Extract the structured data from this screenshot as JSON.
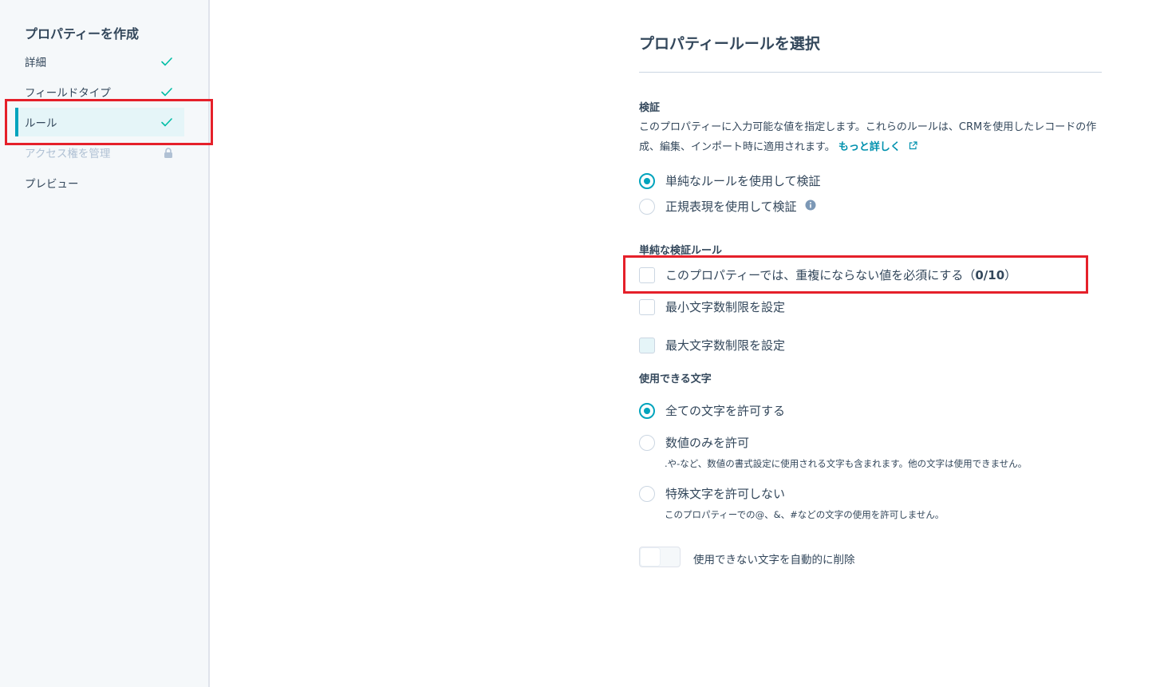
{
  "sidebar": {
    "title": "プロパティーを作成",
    "steps": [
      {
        "label": "詳細",
        "status": "check-icon"
      },
      {
        "label": "フィールドタイプ",
        "status": "check-icon"
      },
      {
        "label": "ルール",
        "status": "check-icon",
        "active": true
      },
      {
        "label": "アクセス権を管理",
        "status": "lock-icon",
        "disabled": true
      },
      {
        "label": "プレビュー"
      }
    ]
  },
  "main": {
    "title": "プロパティールールを選択",
    "validation": {
      "label": "検証",
      "description": "このプロパティーに入力可能な値を指定します。これらのルールは、CRMを使用したレコードの作成、編集、インポート時に適用されます。",
      "learn_more": "もっと詳しく",
      "options": [
        {
          "label": "単純なルールを使用して検証",
          "checked": true
        },
        {
          "label": "正規表現を使用して検証",
          "checked": false,
          "icon": "info-icon"
        }
      ]
    },
    "simple_rules": {
      "label": "単純な検証ルール",
      "options": [
        {
          "label": "このプロパティーでは、重複にならない値を必須にする（",
          "count": "0/10",
          "suffix": "）"
        },
        {
          "label": "最小文字数制限を設定"
        },
        {
          "label": "最大文字数制限を設定",
          "disabled": true
        }
      ]
    },
    "allowed_chars": {
      "label": "使用できる文字",
      "options": [
        {
          "label": "全ての文字を許可する",
          "checked": true
        },
        {
          "label": "数値のみを許可",
          "checked": false,
          "description": ".や-など、数値の書式設定に使用される文字も含まれます。他の文字は使用できません。"
        },
        {
          "label": "特殊文字を許可しない",
          "checked": false,
          "description": "このプロパティーでの@、&、#などの文字の使用を許可しません。"
        }
      ]
    },
    "auto_remove": {
      "label": "使用できない文字を自動的に削除",
      "on": false
    }
  },
  "colors": {
    "accent": "#00a4bd",
    "highlight": "#e5202a",
    "text": "#33475b",
    "link": "#0091ae"
  }
}
